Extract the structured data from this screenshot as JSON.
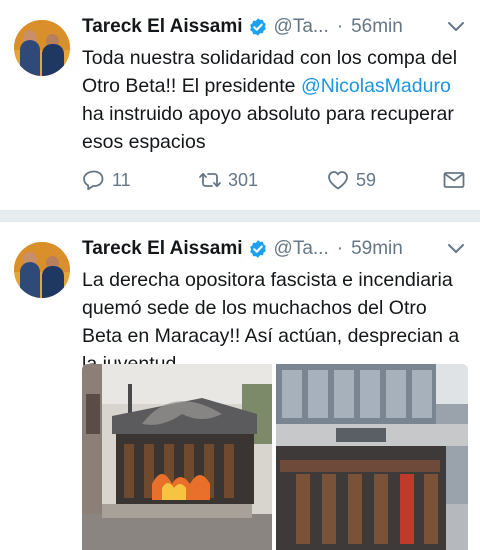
{
  "tweets": [
    {
      "author_name": "Tareck El Aissami",
      "handle": "@Ta...",
      "separator": "·",
      "time": "56min",
      "text_part1": "Toda nuestra solidaridad con los compa del Otro Beta!! El presidente ",
      "mention": "@NicolasMaduro",
      "text_part2": " ha instruido apoyo absoluto para recuperar esos espacios",
      "replies": "11",
      "retweets": "301",
      "likes": "59",
      "icons": [
        "reply-icon",
        "retweet-icon",
        "like-icon",
        "dm-icon"
      ]
    },
    {
      "author_name": "Tareck El Aissami",
      "handle": "@Ta...",
      "separator": "·",
      "time": "59min",
      "text": "La derecha opositora fascista e incendiaria quemó sede de los muchachos del Otro Beta en Maracay!! Así actúan, desprecian a la juventud."
    }
  ],
  "colors": {
    "verified": "#1da1f2",
    "mention": "#1b95e0",
    "secondary": "#657786",
    "separator": "#e6ecf0"
  }
}
